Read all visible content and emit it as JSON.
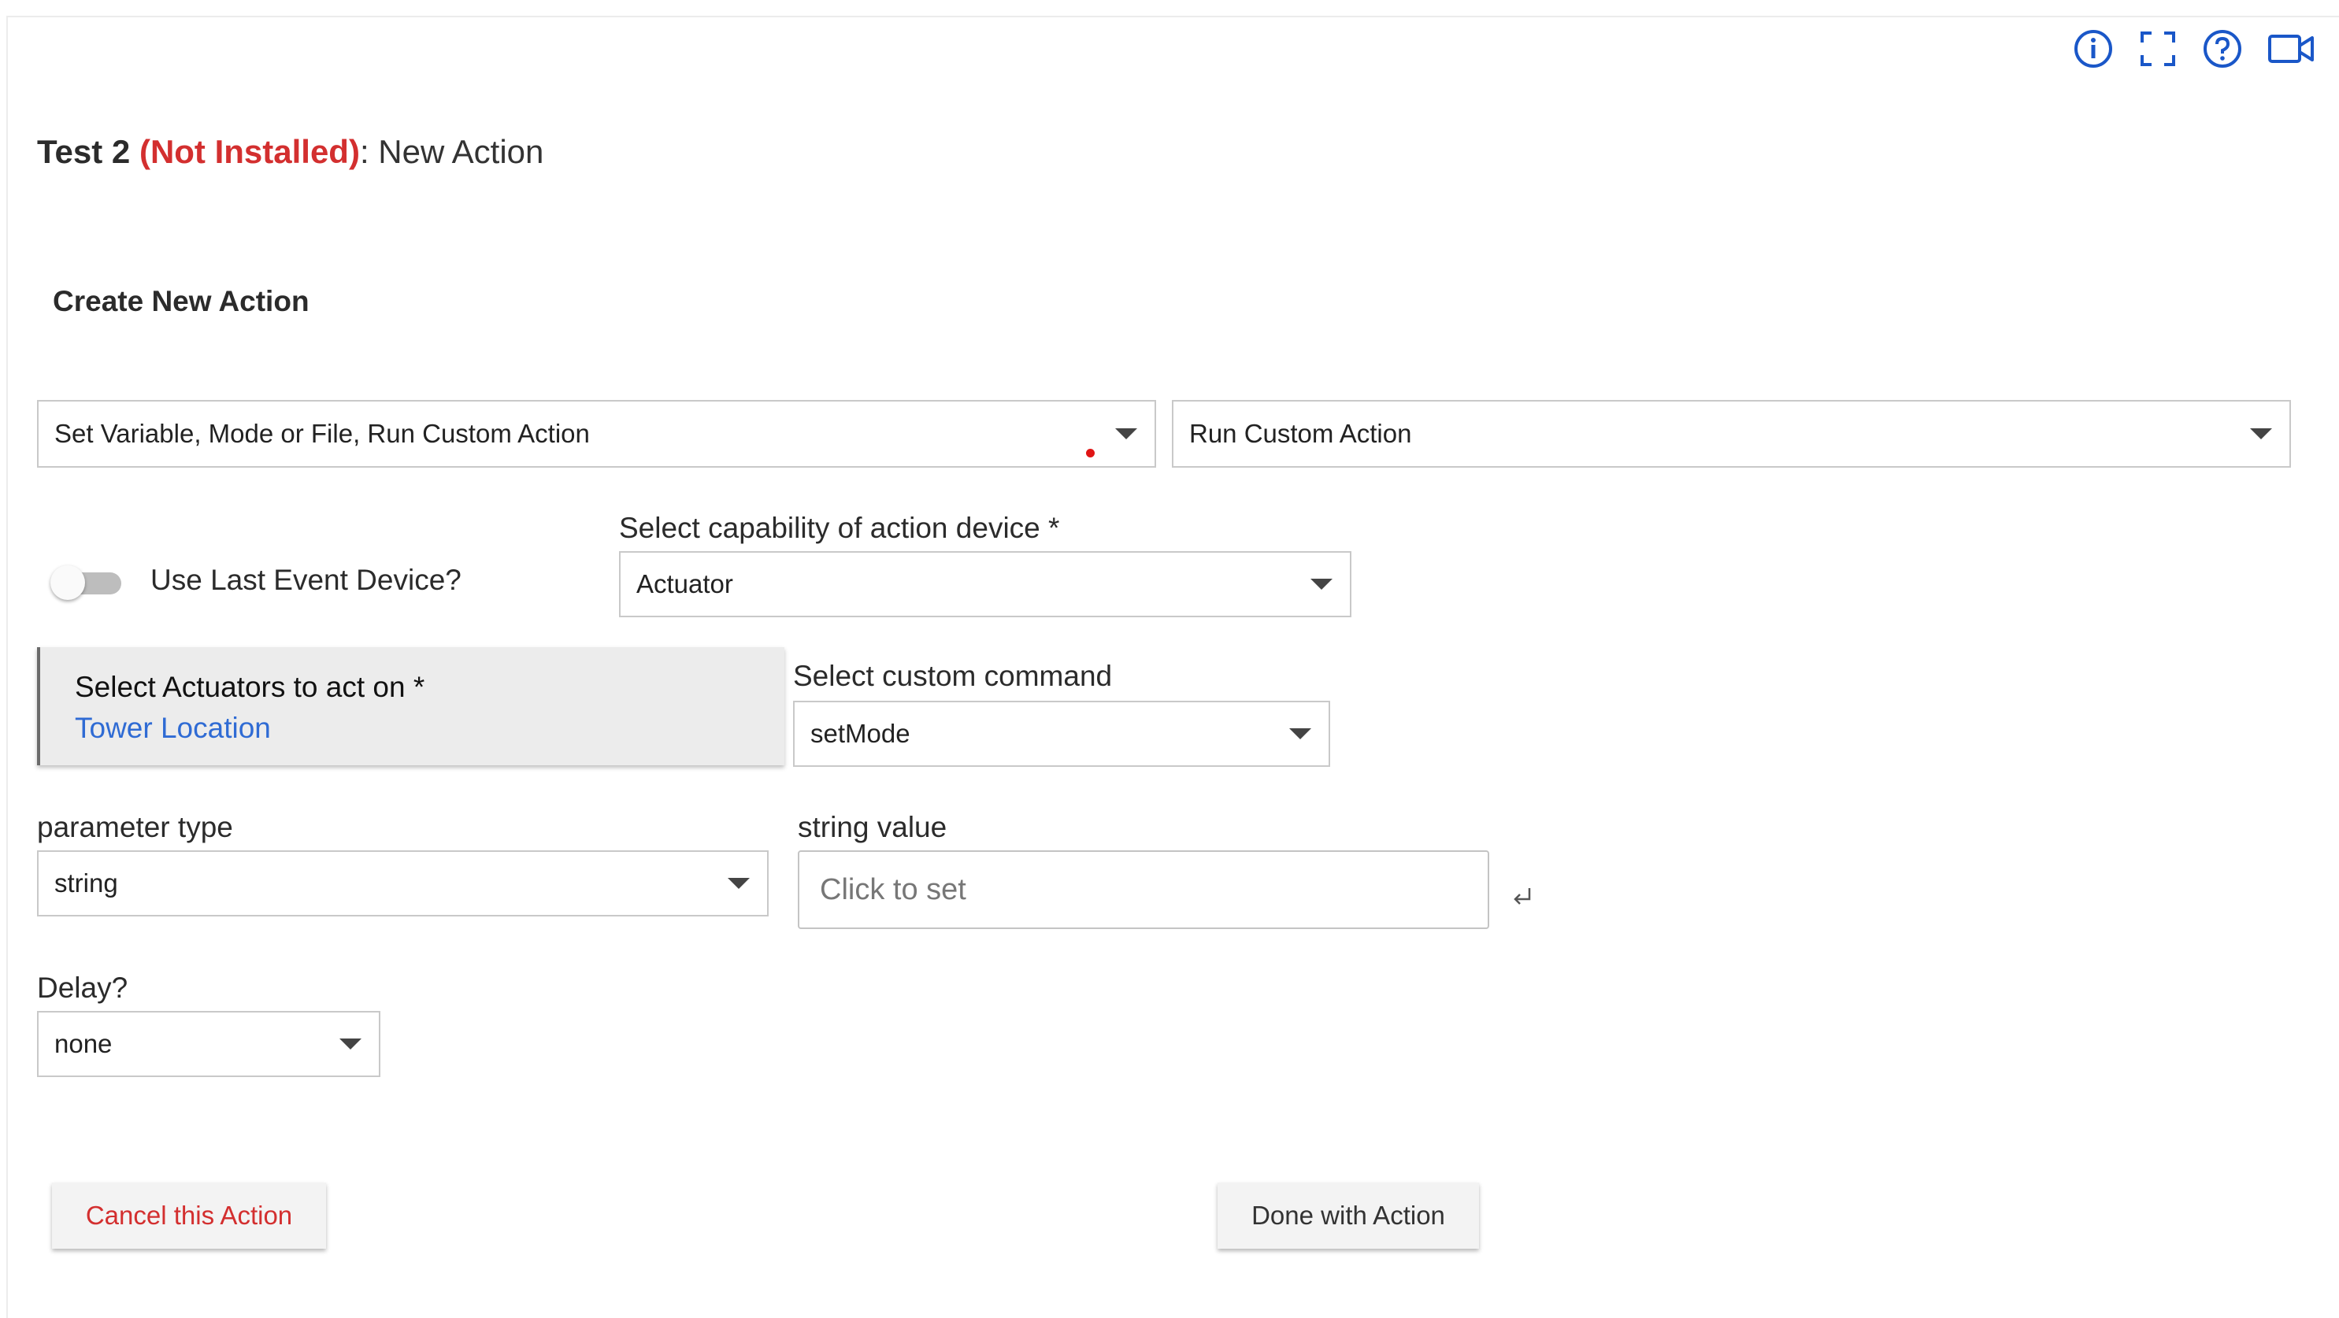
{
  "header": {
    "icons": [
      "info-icon",
      "fullscreen-icon",
      "help-icon",
      "video-icon"
    ],
    "app_name": "Test 2",
    "status": "(Not Installed)",
    "separator_and_page": ": New Action"
  },
  "section": {
    "title": "Create New Action"
  },
  "action_type": {
    "value": "Set Variable, Mode or File, Run Custom Action"
  },
  "action_subtype": {
    "value": "Run Custom Action"
  },
  "use_last_event": {
    "label": "Use Last Event Device?",
    "on": false
  },
  "capability": {
    "label": "Select capability of action device *",
    "value": "Actuator"
  },
  "devices": {
    "title": "Select Actuators to act on *",
    "value": "Tower Location"
  },
  "custom_command": {
    "label": "Select custom command",
    "value": "setMode"
  },
  "parameter_type": {
    "label": "parameter type",
    "value": "string"
  },
  "string_value": {
    "label": "string value",
    "placeholder": "Click to set"
  },
  "delay": {
    "label": "Delay?",
    "value": "none"
  },
  "buttons": {
    "cancel": "Cancel this Action",
    "done": "Done with Action"
  },
  "colors": {
    "accent": "#2f6bd4",
    "danger": "#d32f2f",
    "icon_blue": "#1a57c8"
  }
}
